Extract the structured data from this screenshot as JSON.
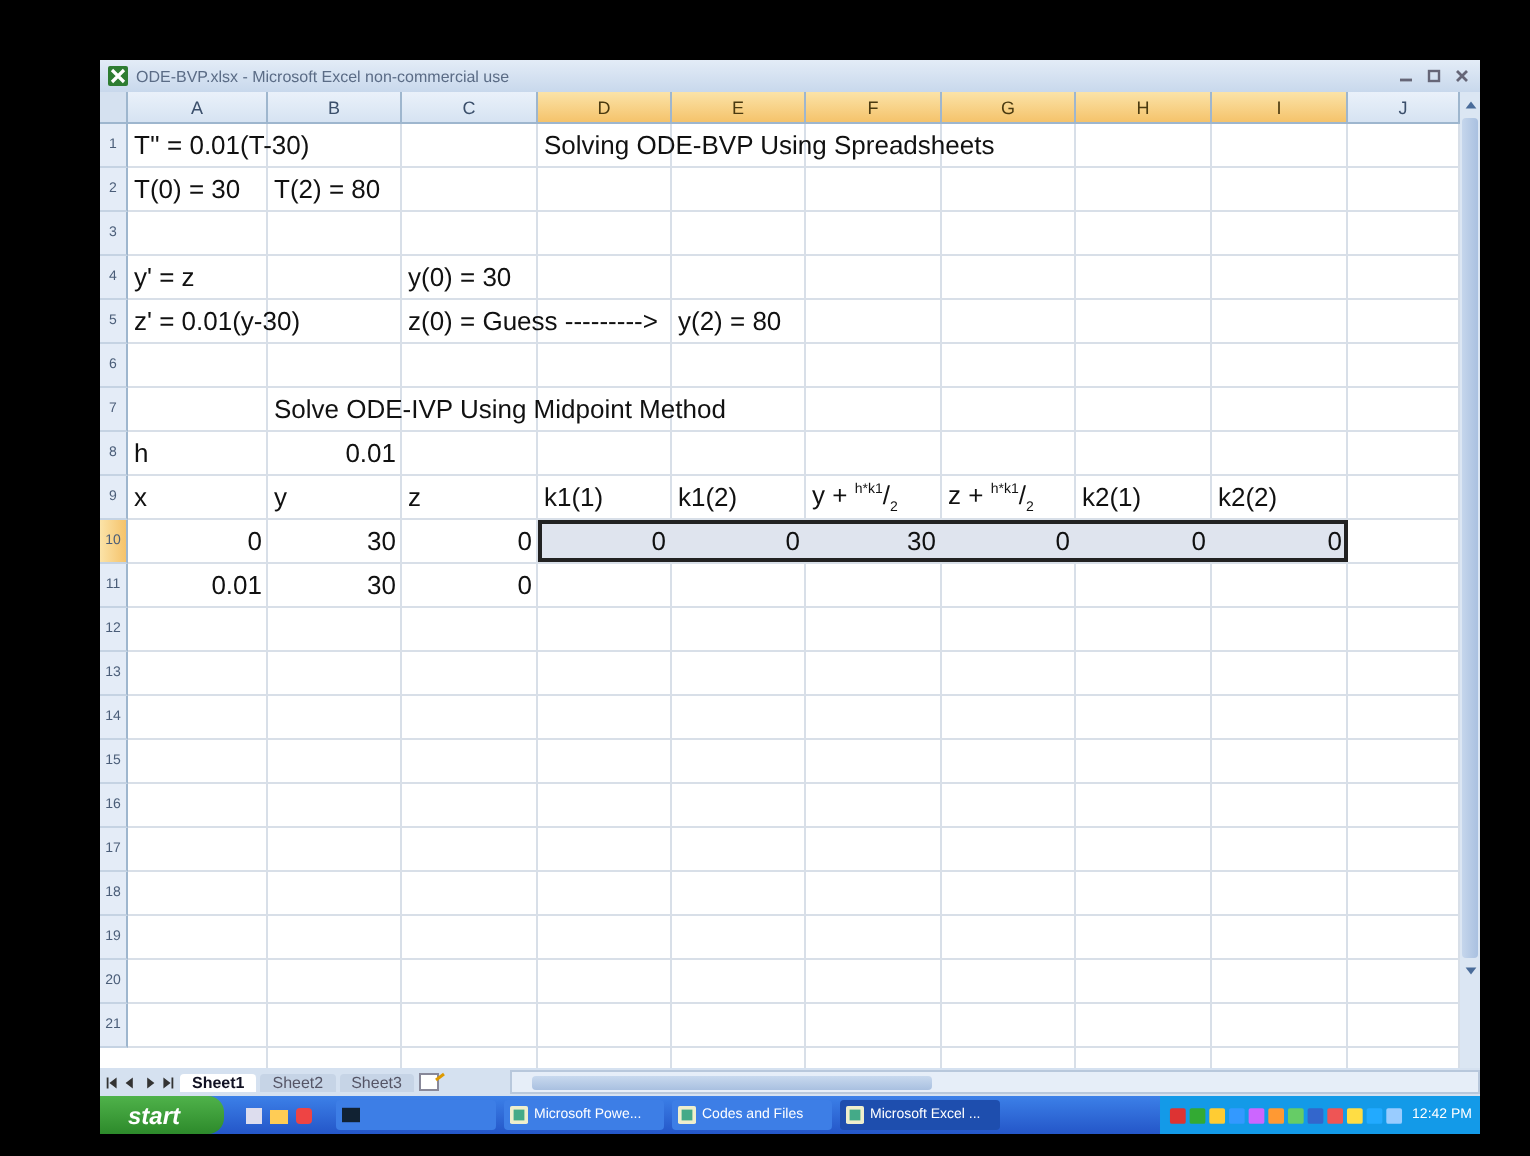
{
  "window": {
    "title": "ODE-BVP.xlsx - Microsoft Excel non-commercial use"
  },
  "columns": [
    {
      "label": "A",
      "selected": false
    },
    {
      "label": "B",
      "selected": false
    },
    {
      "label": "C",
      "selected": false
    },
    {
      "label": "D",
      "selected": true
    },
    {
      "label": "E",
      "selected": true
    },
    {
      "label": "F",
      "selected": true
    },
    {
      "label": "G",
      "selected": true
    },
    {
      "label": "H",
      "selected": true
    },
    {
      "label": "I",
      "selected": true
    },
    {
      "label": "J",
      "selected": false
    }
  ],
  "rows": [
    {
      "number": "1",
      "selected": false,
      "cells": {
        "a": {
          "text": "T'' = 0.01(T-30)",
          "kind": "text",
          "selected": false
        },
        "d": {
          "text": "Solving ODE-BVP Using Spreadsheets",
          "kind": "text",
          "selected": false
        }
      }
    },
    {
      "number": "2",
      "selected": false,
      "cells": {
        "a": {
          "text": "T(0) = 30",
          "kind": "text",
          "selected": false
        },
        "b": {
          "text": "T(2) = 80",
          "kind": "text",
          "selected": false
        }
      }
    },
    {
      "number": "3",
      "selected": false,
      "cells": {}
    },
    {
      "number": "4",
      "selected": false,
      "cells": {
        "a": {
          "text": "y' = z",
          "kind": "text",
          "selected": false
        },
        "c": {
          "text": "y(0) = 30",
          "kind": "text",
          "selected": false
        }
      }
    },
    {
      "number": "5",
      "selected": false,
      "cells": {
        "a": {
          "text": "z' = 0.01(y-30)",
          "kind": "text",
          "selected": false
        },
        "c": {
          "text": "z(0) = Guess --------->",
          "kind": "text",
          "selected": false
        },
        "e": {
          "text": "y(2) = 80",
          "kind": "text",
          "selected": false
        }
      }
    },
    {
      "number": "6",
      "selected": false,
      "cells": {}
    },
    {
      "number": "7",
      "selected": false,
      "cells": {
        "b": {
          "text": "Solve ODE-IVP Using Midpoint Method",
          "kind": "text",
          "selected": false
        }
      }
    },
    {
      "number": "8",
      "selected": false,
      "cells": {
        "a": {
          "text": "h",
          "kind": "text",
          "selected": false
        },
        "b": {
          "text": "0.01",
          "kind": "number",
          "selected": false
        }
      }
    },
    {
      "number": "9",
      "selected": false,
      "cells": {
        "a": {
          "text": "x",
          "kind": "text",
          "selected": false
        },
        "b": {
          "text": "y",
          "kind": "text",
          "selected": false
        },
        "c": {
          "text": "z",
          "kind": "text",
          "selected": false
        },
        "d": {
          "text": "k1(1)",
          "kind": "text",
          "selected": false
        },
        "e": {
          "text": "k1(2)",
          "kind": "text",
          "selected": false
        },
        "f": {
          "text": "y + $^{h*k1}$/$_{2}$",
          "kind": "text",
          "selected": false
        },
        "g": {
          "text": "z + $^{h*k1}$/$_{2}$",
          "kind": "text",
          "selected": false
        },
        "h": {
          "text": "k2(1)",
          "kind": "text",
          "selected": false
        },
        "i": {
          "text": "k2(2)",
          "kind": "text",
          "selected": false
        }
      }
    },
    {
      "number": "10",
      "selected": true,
      "cells": {
        "a": {
          "text": "0",
          "kind": "number",
          "selected": false
        },
        "b": {
          "text": "30",
          "kind": "number",
          "selected": false
        },
        "c": {
          "text": "0",
          "kind": "number",
          "selected": false
        },
        "d": {
          "text": "0",
          "kind": "number",
          "selected": true
        },
        "e": {
          "text": "0",
          "kind": "number",
          "selected": true
        },
        "f": {
          "text": "30",
          "kind": "number",
          "selected": true
        },
        "g": {
          "text": "0",
          "kind": "number",
          "selected": true
        },
        "h": {
          "text": "0",
          "kind": "number",
          "selected": true
        },
        "i": {
          "text": "0",
          "kind": "number",
          "selected": true
        }
      }
    },
    {
      "number": "11",
      "selected": false,
      "cells": {
        "a": {
          "text": "0.01",
          "kind": "number",
          "selected": false
        },
        "b": {
          "text": "30",
          "kind": "number",
          "selected": false
        },
        "c": {
          "text": "0",
          "kind": "number",
          "selected": false
        }
      }
    },
    {
      "number": "12",
      "selected": false,
      "cells": {}
    },
    {
      "number": "13",
      "selected": false,
      "cells": {}
    },
    {
      "number": "14",
      "selected": false,
      "cells": {}
    },
    {
      "number": "15",
      "selected": false,
      "cells": {}
    },
    {
      "number": "16",
      "selected": false,
      "cells": {}
    },
    {
      "number": "17",
      "selected": false,
      "cells": {}
    },
    {
      "number": "18",
      "selected": false,
      "cells": {}
    },
    {
      "number": "19",
      "selected": false,
      "cells": {}
    },
    {
      "number": "20",
      "selected": false,
      "cells": {}
    },
    {
      "number": "21",
      "selected": false,
      "cells": {}
    }
  ],
  "sheet_tabs": [
    {
      "label": "Sheet1",
      "selected": true
    },
    {
      "label": "Sheet2",
      "selected": false
    },
    {
      "label": "Sheet3",
      "selected": false
    }
  ],
  "taskbar": {
    "start": "start",
    "items": [
      {
        "label": "Microsoft Powe...",
        "selected": false
      },
      {
        "label": "Codes and Files",
        "selected": false
      },
      {
        "label": "Microsoft Excel ...",
        "selected": true
      }
    ],
    "clock": "12:42 PM"
  }
}
